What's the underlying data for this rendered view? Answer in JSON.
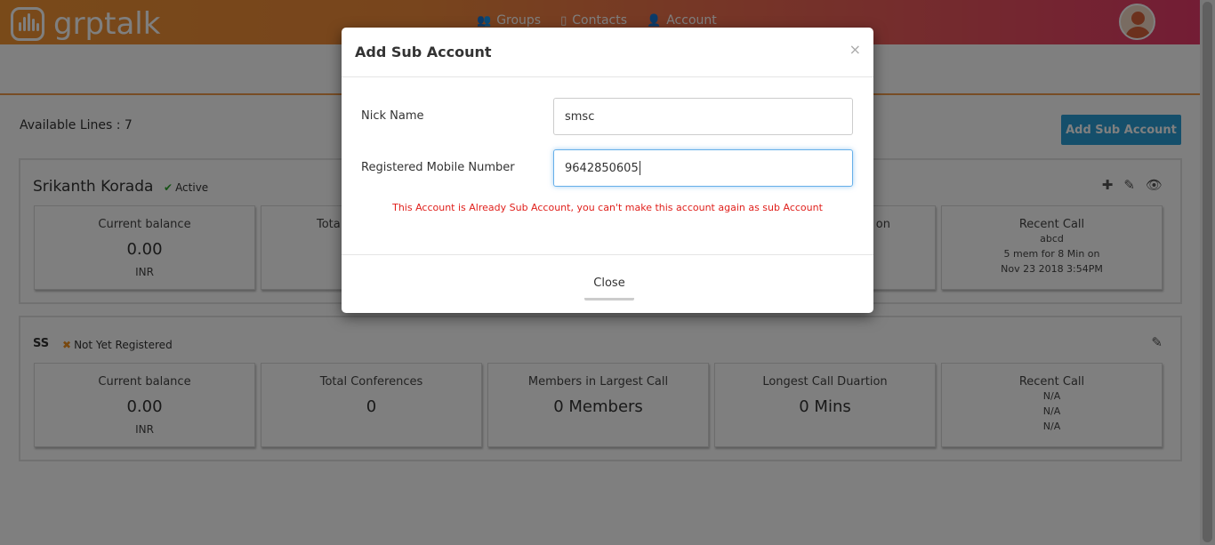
{
  "header": {
    "logo_text": "grptalk",
    "nav": [
      {
        "label": "Groups",
        "icon": "users-icon"
      },
      {
        "label": "Contacts",
        "icon": "contacts-icon"
      },
      {
        "label": "Account",
        "icon": "user-icon"
      }
    ]
  },
  "main": {
    "available_lines": "Available Lines : 7",
    "add_sub_account_label": "Add Sub Account"
  },
  "accounts": [
    {
      "name": "Srikanth Korada",
      "status": "Active",
      "cards": {
        "current_balance": {
          "label": "Current balance",
          "value": "0.00",
          "unit": "INR"
        },
        "total_conferences_partial": "Tota",
        "longest_partial": "on",
        "recent_call": {
          "label": "Recent Call",
          "line1": "abcd",
          "line2": "5 mem for 8 Min on",
          "line3": "Nov 23 2018 3:54PM"
        }
      }
    },
    {
      "name": "SS",
      "status": "Not Yet Registered",
      "cards": {
        "current_balance": {
          "label": "Current balance",
          "value": "0.00",
          "unit": "INR"
        },
        "total_conferences": {
          "label": "Total Conferences",
          "value": "0"
        },
        "members_largest": {
          "label": "Members in Largest Call",
          "value": "0 Members"
        },
        "longest_call": {
          "label": "Longest Call Duartion",
          "value": "0 Mins"
        },
        "recent_call": {
          "label": "Recent Call",
          "line1": "N/A",
          "line2": "N/A",
          "line3": "N/A"
        }
      }
    }
  ],
  "modal": {
    "title": "Add Sub Account",
    "close_x": "×",
    "nick_name_label": "Nick Name",
    "nick_name_value": "smsc",
    "mobile_label": "Registered Mobile Number",
    "mobile_value": "9642850605",
    "error": "This Account is Already Sub Account, you can't make this account again as sub Account",
    "close_button": "Close"
  },
  "colors": {
    "accent": "#2a9fd6",
    "error": "#e0201c",
    "active": "#2aa52a",
    "warning": "#f0901e"
  }
}
